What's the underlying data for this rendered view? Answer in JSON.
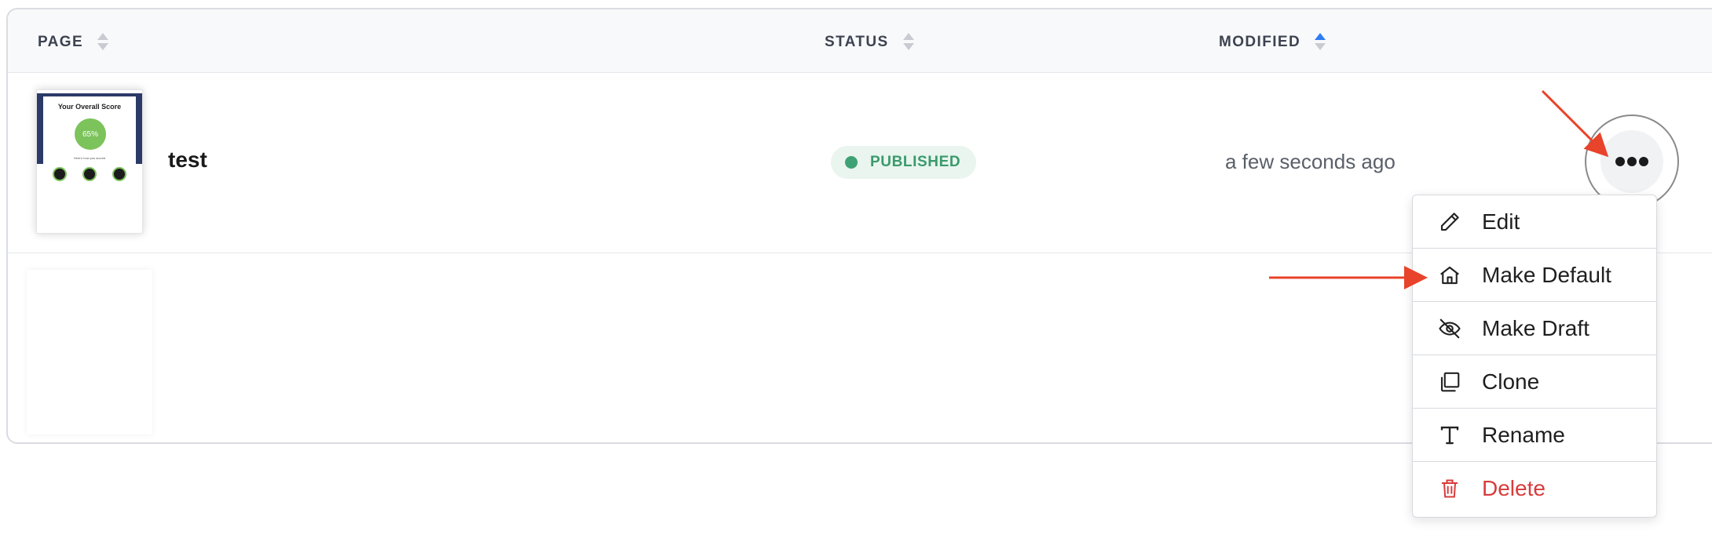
{
  "table": {
    "columns": [
      {
        "label": "PAGE",
        "sort": "none"
      },
      {
        "label": "STATUS",
        "sort": "none"
      },
      {
        "label": "MODIFIED",
        "sort": "ascending"
      }
    ],
    "rows": [
      {
        "page_name": "test",
        "status": "PUBLISHED",
        "modified": "a few seconds ago",
        "thumbnail": {
          "title": "Your Overall Score",
          "score": "65%",
          "subtitle": "Here's how you scored"
        }
      }
    ]
  },
  "row_menu": {
    "items": [
      {
        "label": "Edit",
        "icon": "pencil-icon"
      },
      {
        "label": "Make Default",
        "icon": "home-icon"
      },
      {
        "label": "Make Draft",
        "icon": "eye-slash-icon"
      },
      {
        "label": "Clone",
        "icon": "copy-icon"
      },
      {
        "label": "Rename",
        "icon": "text-icon"
      },
      {
        "label": "Delete",
        "icon": "trash-icon"
      }
    ]
  },
  "colors": {
    "accent": "#2e7df6",
    "published": "#3fa274",
    "danger": "#d93b3b",
    "annotation_arrow": "#e8432b"
  }
}
